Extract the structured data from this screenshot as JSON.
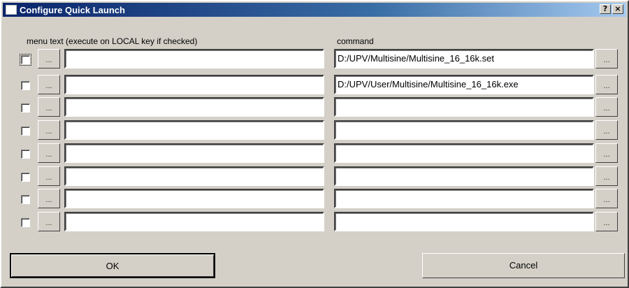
{
  "window": {
    "title": "Configure Quick Launch",
    "help_label": "?",
    "close_label": "×"
  },
  "headers": {
    "menu_text": "menu text (execute on LOCAL key if checked)",
    "command": "command"
  },
  "ellipsis": "...",
  "rows": [
    {
      "checked": false,
      "menu_text": "",
      "command": "D:/UPV/Multisine/Multisine_16_16k.set"
    },
    {
      "checked": false,
      "menu_text": "",
      "command": "D:/UPV/User/Multisine/Multisine_16_16k.exe"
    },
    {
      "checked": false,
      "menu_text": "",
      "command": ""
    },
    {
      "checked": false,
      "menu_text": "",
      "command": ""
    },
    {
      "checked": false,
      "menu_text": "",
      "command": ""
    },
    {
      "checked": false,
      "menu_text": "",
      "command": ""
    },
    {
      "checked": false,
      "menu_text": "",
      "command": ""
    },
    {
      "checked": false,
      "menu_text": "",
      "command": ""
    }
  ],
  "buttons": {
    "ok": "OK",
    "cancel": "Cancel"
  }
}
